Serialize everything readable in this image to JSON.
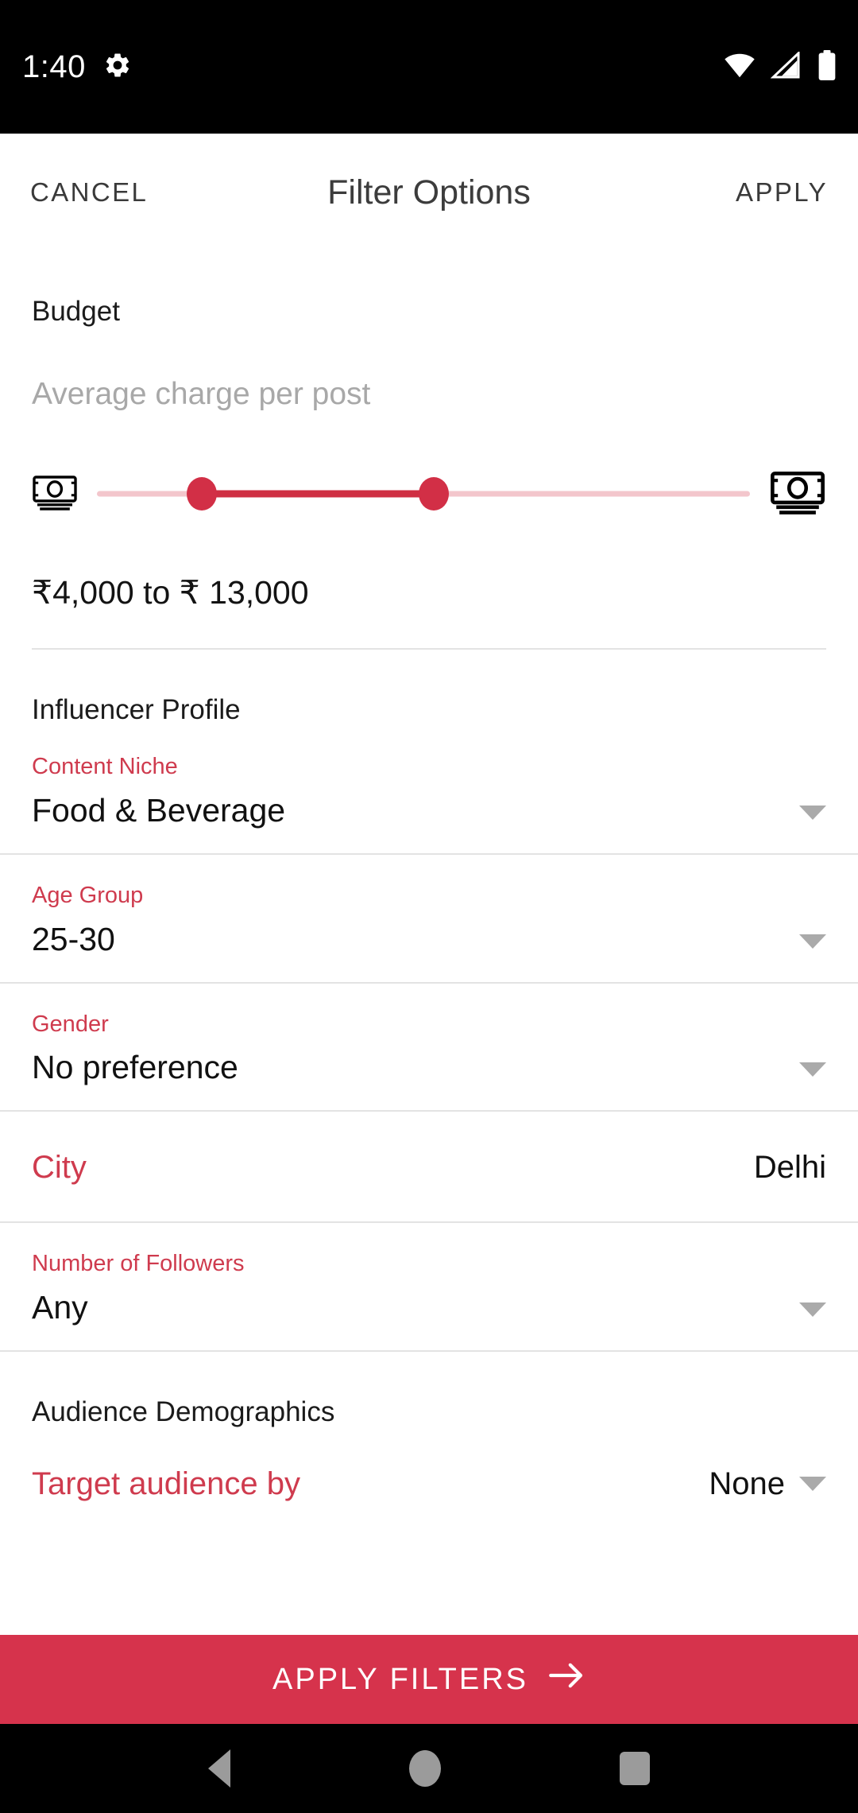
{
  "status_bar": {
    "time": "1:40",
    "icons": [
      "gear-icon",
      "wifi-icon",
      "cellular-signal-icon",
      "battery-icon"
    ]
  },
  "app_bar": {
    "cancel_label": "CANCEL",
    "title": "Filter Options",
    "apply_label": "APPLY"
  },
  "budget": {
    "section_title": "Budget",
    "subtitle": "Average charge per post",
    "range_text": "₹4,000 to ₹ 13,000",
    "min_icon": "money-icon",
    "max_icon": "money-icon",
    "slider": {
      "low_percent": 16,
      "high_percent": 51.6
    }
  },
  "influencer_profile": {
    "section_title": "Influencer Profile",
    "fields": [
      {
        "label": "Content Niche",
        "value": "Food & Beverage",
        "caret": true
      },
      {
        "label": "Age Group",
        "value": "25-30",
        "caret": true
      },
      {
        "label": "Gender",
        "value": "No preference",
        "caret": true
      }
    ],
    "city": {
      "label": "City",
      "value": "Delhi"
    },
    "followers": {
      "label": "Number of Followers",
      "value": "Any",
      "caret": true
    }
  },
  "audience_demographics": {
    "section_title": "Audience Demographics",
    "target_audience": {
      "label": "Target audience by",
      "value": "None"
    }
  },
  "cta": {
    "label": "APPLY FILTERS",
    "icon": "arrow-right-icon"
  },
  "nav_bar": {
    "back": "back-icon",
    "home": "home-icon",
    "recents": "recents-icon"
  },
  "colors": {
    "accent_red": "#cf3b4e",
    "cta_red": "#d6334c",
    "slider_track": "#f3c6cc",
    "slider_active": "#cf2f43",
    "muted_gray": "#a8a8a8"
  }
}
